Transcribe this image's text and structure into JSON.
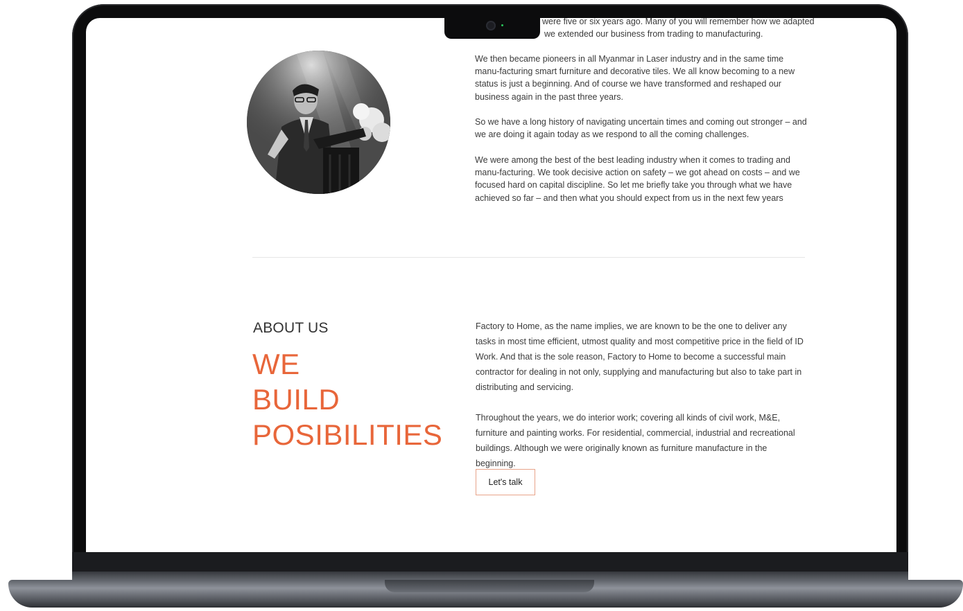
{
  "story": {
    "partial_line_1": "were five or six years ago. Many of you will remember how we adapted",
    "partial_line_2": "we extended our business from trading to manufacturing.",
    "paragraph_2": "We then became pioneers in all Myanmar in Laser industry and in the same time manu-facturing smart furniture and decorative tiles. We all know becoming to a new status is just a beginning. And of course we have transformed and reshaped our business again in the past three years.",
    "paragraph_3": "So we have a long history of navigating uncertain times and coming out stronger – and we are doing it again today as we respond to all the coming challenges.",
    "paragraph_4": "We were among the best of the best leading industry when it comes to trading and manu-facturing. We took decisive action on safety – we got ahead on costs – and we focused hard on capital discipline. So let me briefly take you through what we have achieved so far – and then what you should expect from us in the next few years"
  },
  "about": {
    "label": "ABOUT US",
    "headline_1": "WE",
    "headline_2": "BUILD",
    "headline_3": "POSIBILITIES",
    "paragraph_1": "Factory to Home, as the name implies, we are known to be the one to deliver any tasks in most time efficient, utmost quality and most competitive price in the field of ID Work. And that is the sole reason, Factory to Home to become a successful main contractor for dealing in not only, supplying and manufacturing but also to take part in distributing and servicing.",
    "paragraph_2": "Throughout the years, we do interior work; covering all kinds of civil work, M&E, furniture and painting works. For residential, commercial, industrial and recreational buildings. Although we were originally known as furniture manufacture in the beginning.",
    "cta_label": "Let's talk"
  },
  "colors": {
    "accent": "#e8663a",
    "cta_border": "#e8a48a",
    "text": "#3b3b3b",
    "frame": "#0c0c0d"
  },
  "icons": {
    "camera": "camera-icon"
  }
}
